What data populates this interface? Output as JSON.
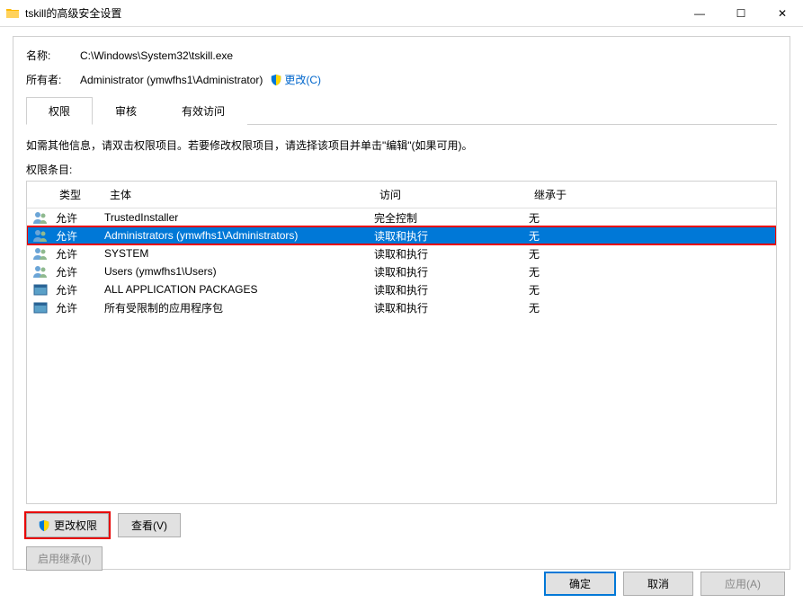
{
  "window": {
    "title": "tskill的高级安全设置",
    "minimize": "—",
    "maximize": "☐",
    "close": "✕"
  },
  "info": {
    "name_label": "名称:",
    "name_value": "C:\\Windows\\System32\\tskill.exe",
    "owner_label": "所有者:",
    "owner_value": "Administrator (ymwfhs1\\Administrator)",
    "change_link": "更改(C)"
  },
  "tabs": {
    "permissions": "权限",
    "auditing": "审核",
    "effective": "有效访问"
  },
  "instruction": "如需其他信息，请双击权限项目。若要修改权限项目，请选择该项目并单击\"编辑\"(如果可用)。",
  "list_label": "权限条目:",
  "columns": {
    "type": "类型",
    "principal": "主体",
    "access": "访问",
    "inherit": "继承于"
  },
  "entries": [
    {
      "icon": "users",
      "type": "允许",
      "principal": "TrustedInstaller",
      "access": "完全控制",
      "inherit": "无",
      "selected": false
    },
    {
      "icon": "users",
      "type": "允许",
      "principal": "Administrators (ymwfhs1\\Administrators)",
      "access": "读取和执行",
      "inherit": "无",
      "selected": true
    },
    {
      "icon": "users",
      "type": "允许",
      "principal": "SYSTEM",
      "access": "读取和执行",
      "inherit": "无",
      "selected": false
    },
    {
      "icon": "users",
      "type": "允许",
      "principal": "Users (ymwfhs1\\Users)",
      "access": "读取和执行",
      "inherit": "无",
      "selected": false
    },
    {
      "icon": "package",
      "type": "允许",
      "principal": "ALL APPLICATION PACKAGES",
      "access": "读取和执行",
      "inherit": "无",
      "selected": false
    },
    {
      "icon": "package",
      "type": "允许",
      "principal": "所有受限制的应用程序包",
      "access": "读取和执行",
      "inherit": "无",
      "selected": false
    }
  ],
  "buttons": {
    "change_perm": "更改权限",
    "view": "查看(V)",
    "enable_inherit": "启用继承(I)",
    "ok": "确定",
    "cancel": "取消",
    "apply": "应用(A)"
  }
}
